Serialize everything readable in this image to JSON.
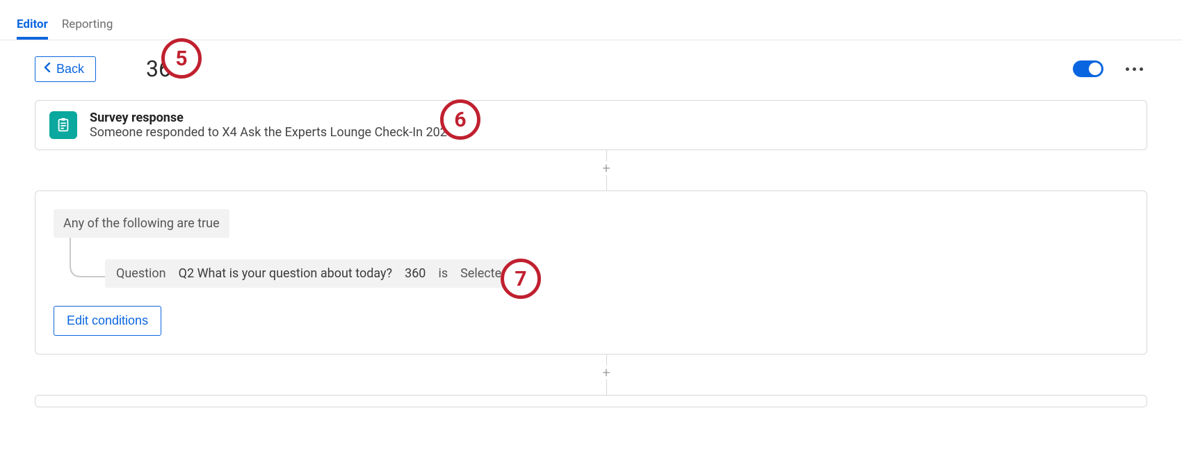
{
  "tabs": {
    "editor": "Editor",
    "reporting": "Reporting"
  },
  "header": {
    "back_label": "Back",
    "title": "360"
  },
  "trigger": {
    "title": "Survey response",
    "subtitle": "Someone responded to X4 Ask the Experts Lounge Check-In 2020"
  },
  "conditions": {
    "group_label": "Any of the following are true",
    "row": {
      "type_label": "Question",
      "question": "Q2 What is your question about today?",
      "choice": "360",
      "op": "is",
      "state": "Selected"
    },
    "edit_label": "Edit conditions"
  },
  "annotations": {
    "a5": "5",
    "a6": "6",
    "a7": "7"
  }
}
